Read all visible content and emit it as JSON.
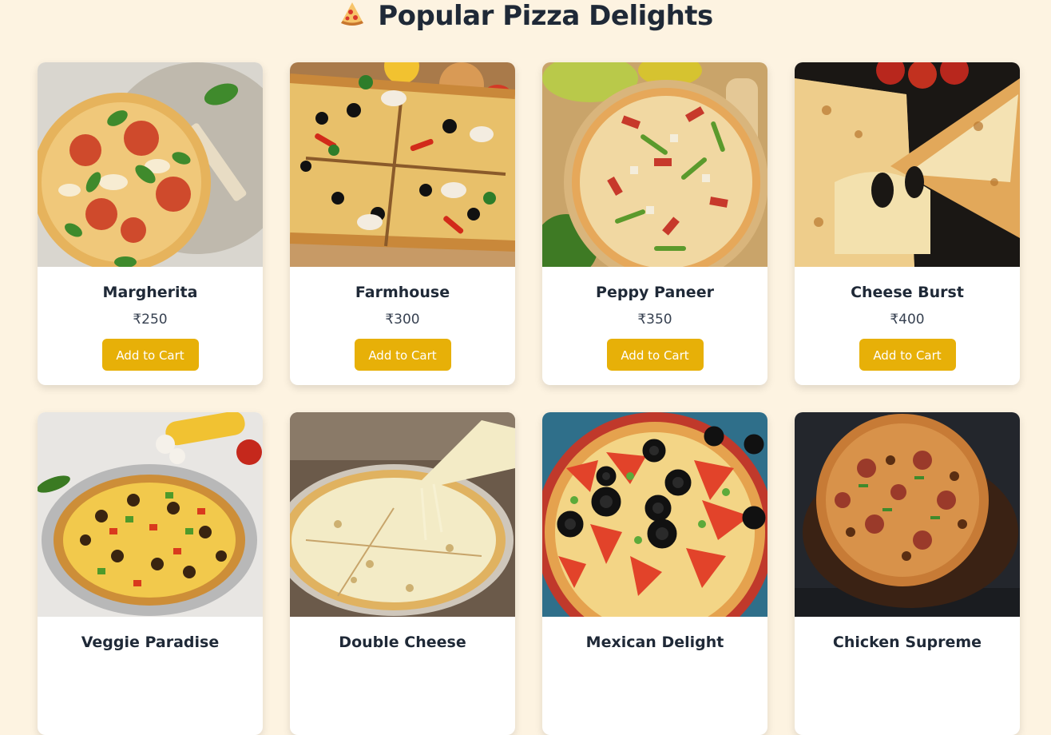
{
  "page": {
    "title": "Popular Pizza Delights",
    "title_icon": "pizza-icon"
  },
  "colors": {
    "background": "#fdf3e1",
    "button": "#e7b008",
    "card": "#ffffff",
    "text": "#1f2937"
  },
  "pizzas": [
    {
      "name": "Margherita",
      "price": "₹250",
      "cta": "Add to Cart"
    },
    {
      "name": "Farmhouse",
      "price": "₹300",
      "cta": "Add to Cart"
    },
    {
      "name": "Peppy Paneer",
      "price": "₹350",
      "cta": "Add to Cart"
    },
    {
      "name": "Cheese Burst",
      "price": "₹400",
      "cta": "Add to Cart"
    },
    {
      "name": "Veggie Paradise",
      "price": "",
      "cta": ""
    },
    {
      "name": "Double Cheese",
      "price": "",
      "cta": ""
    },
    {
      "name": "Mexican Delight",
      "price": "",
      "cta": ""
    },
    {
      "name": "Chicken Supreme",
      "price": "",
      "cta": ""
    }
  ]
}
